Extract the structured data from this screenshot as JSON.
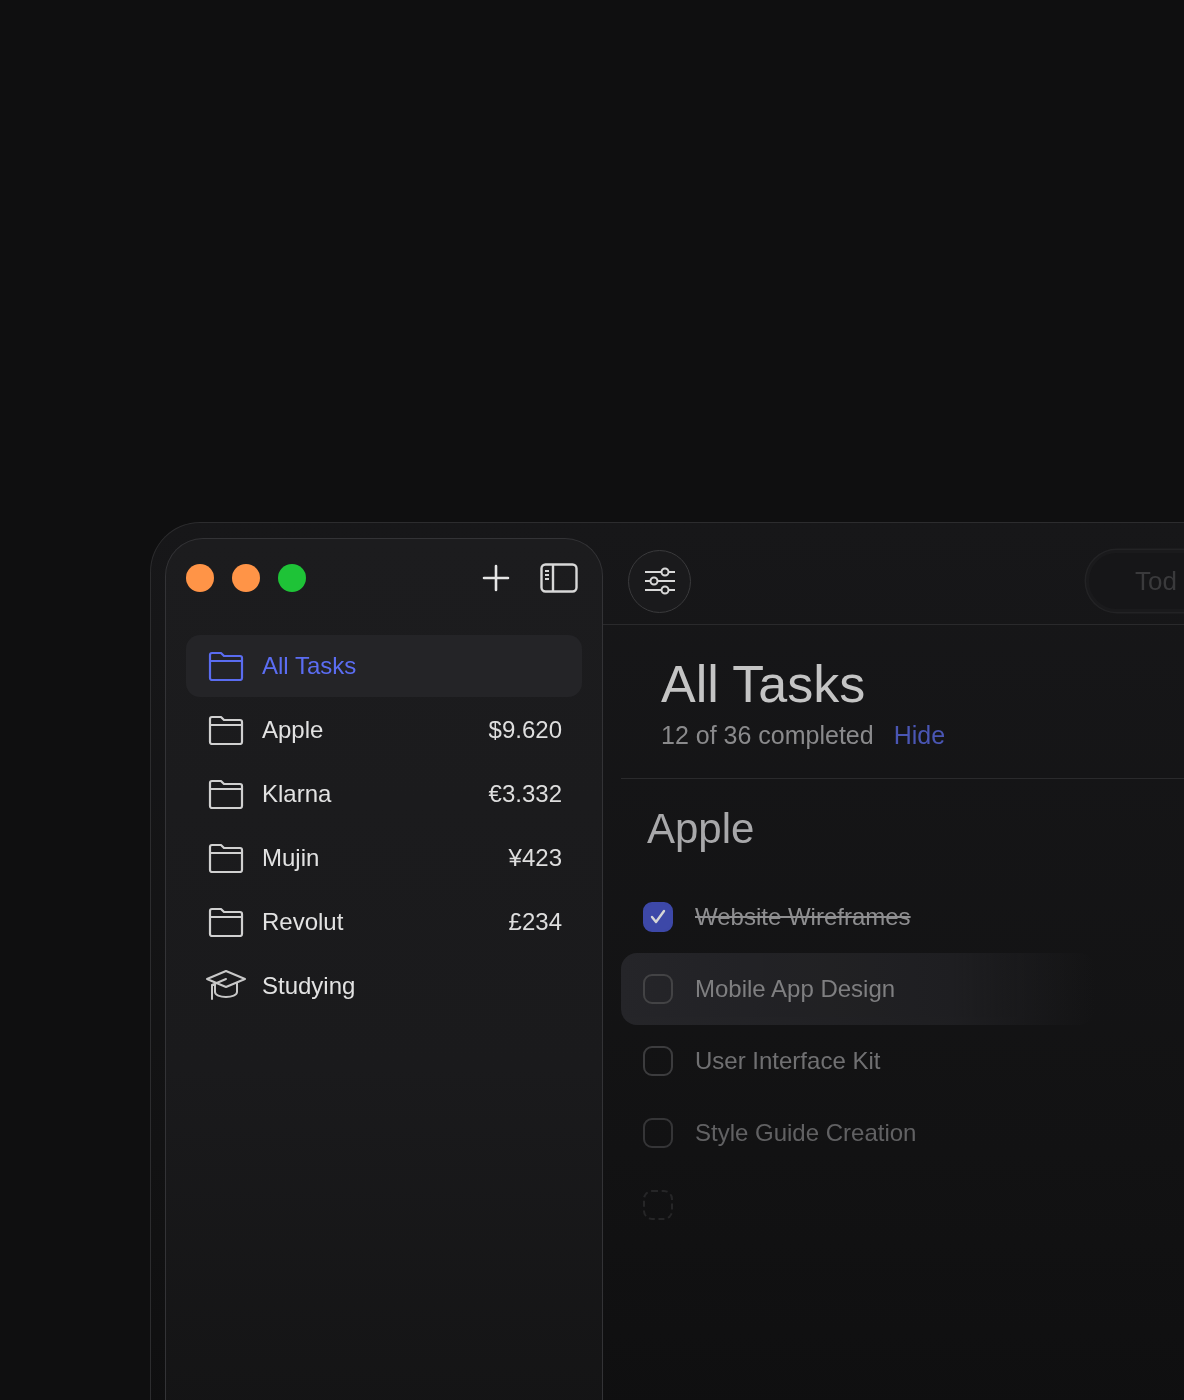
{
  "window_controls": [
    {
      "color": "#ff9447"
    },
    {
      "color": "#ff9447"
    },
    {
      "color": "#1ec337"
    }
  ],
  "sidebar": {
    "items": [
      {
        "kind": "folder",
        "label": "All Tasks",
        "selected": true
      },
      {
        "kind": "folder",
        "label": "Apple",
        "amount": "$9.620",
        "selected": false
      },
      {
        "kind": "folder",
        "label": "Klarna",
        "amount": "€3.332",
        "selected": false
      },
      {
        "kind": "folder",
        "label": "Mujin",
        "amount": "¥423",
        "selected": false
      },
      {
        "kind": "folder",
        "label": "Revolut",
        "amount": "£234",
        "selected": false
      },
      {
        "kind": "cap",
        "label": "Studying",
        "selected": false
      }
    ]
  },
  "toolbar": {
    "pill_label": "Tod"
  },
  "header": {
    "title": "All Tasks",
    "progress": "12 of 36 completed",
    "toggle": "Hide"
  },
  "sections": [
    {
      "title": "Apple",
      "tasks": [
        {
          "kind": "task",
          "label": "Website Wireframes",
          "checked": true,
          "selected": false
        },
        {
          "kind": "task",
          "label": "Mobile App Design",
          "checked": false,
          "selected": true
        },
        {
          "kind": "task",
          "label": "User Interface Kit",
          "checked": false,
          "selected": false
        },
        {
          "kind": "task",
          "label": "Style Guide Creation",
          "checked": false,
          "selected": false
        },
        {
          "kind": "new",
          "checked": false,
          "selected": false
        }
      ]
    }
  ]
}
